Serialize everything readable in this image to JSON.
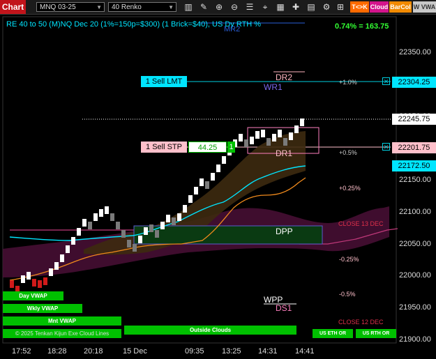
{
  "toolbar": {
    "tab_label": "Chart",
    "instrument": "MNQ 03-25",
    "bar_type": "40 Renko",
    "btn_tk": "T<>K",
    "btn_cloud": "Cloud",
    "btn_barcol": "BarCol",
    "btn_vwap": "W VWA",
    "colors": {
      "tab": "#c1141b",
      "tk": "#ff6a00",
      "cloud": "#d4148c",
      "barcol": "#f28a00",
      "vwap": "#c8c8c8"
    }
  },
  "header": {
    "indicator_text": "RE 40 to 50 (M)NQ Dec 20 (1%=150p=$300) (1 Brick=$40), US Dy RTH %",
    "mr2": "MR2",
    "change": "0.74% = 163.75"
  },
  "price_axis": {
    "ticks": [
      "22350.00",
      "22300.00",
      "22250.00",
      "22150.00",
      "22100.00",
      "22050.00",
      "22000.00",
      "21950.00",
      "21900.00"
    ],
    "tick_values": [
      22350,
      22300,
      22250,
      22150,
      22100,
      22050,
      22000,
      21950,
      21900
    ],
    "markers": [
      {
        "label": "22304.25",
        "value": 22304.25,
        "color": "#00e5ff"
      },
      {
        "label": "22245.75",
        "value": 22245.75,
        "color": "#ffffff"
      },
      {
        "label": "22201.75",
        "value": 22201.75,
        "color": "#ffc0cb"
      },
      {
        "label": "22172.50",
        "value": 22172.5,
        "color": "#00e5ff"
      }
    ]
  },
  "time_axis": [
    "17:52",
    "18:28",
    "20:18",
    "15 Dec",
    "09:35",
    "13:25",
    "14:31",
    "14:41"
  ],
  "orders": {
    "sell_lmt": "1 Sell LMT",
    "sell_stp": "1 Sell STP",
    "stp_pnl": "44.25",
    "stp_qty": "1",
    "close_x": "✕"
  },
  "levels": {
    "dr2": "DR2",
    "wr1": "WR1",
    "dr1": "DR1",
    "dpp": "DPP",
    "wpp": "WPP",
    "ds1": "DS1",
    "p1": "+1.0%",
    "p05": "+0.5%",
    "p025": "+0.25%",
    "m025": "-0.25%",
    "m05": "-0.5%",
    "close13": "CLOSE 13 DEC",
    "close12": "CLOSE 12 DEC"
  },
  "buttons": {
    "day_vwap": "Day VWAP",
    "wkly_vwap": "Wkly VWAP",
    "mnt_vwap": "Mnt VWAP",
    "outside_clouds": "Outside Clouds",
    "us_eth_or": "US ETH OR",
    "us_rth_or": "US RTH OR",
    "copyright": "© 2025 Tenkan Kijun Exe Cloud Lines"
  },
  "chart_data": {
    "type": "renko",
    "ylim": [
      21900,
      22385
    ],
    "brick_size": 10,
    "bricks_up_end": [
      22010,
      22020,
      22030,
      22040,
      22050,
      22060,
      22070,
      22080,
      22090,
      22100,
      22110,
      22120,
      22130,
      22140,
      22150,
      22160,
      22170,
      22180,
      22190,
      22200,
      22210,
      22220,
      22230,
      22240,
      22250
    ],
    "last_price": 22245.75
  }
}
